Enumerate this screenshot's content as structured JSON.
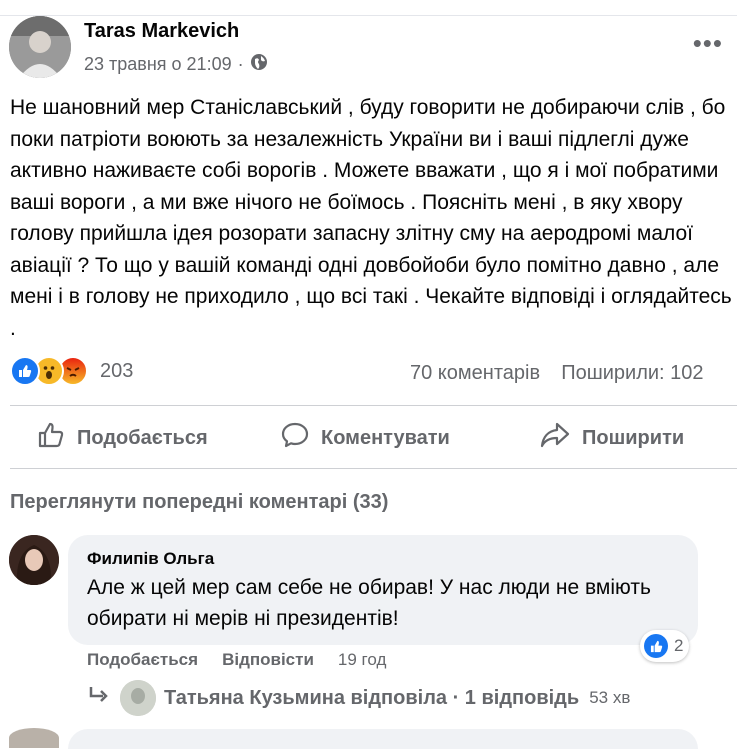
{
  "post": {
    "author": "Taras Markevich",
    "timestamp": "23 травня о 21:09",
    "separator": "·",
    "audience_icon": "globe-icon",
    "more_icon": "more-options-icon",
    "more_label": "•••",
    "text": "Не шановний мер Станіславський , буду говорити не добираючи слів , бо поки патріоти воюють за незалежність України ви і ваші підлеглі дуже активно наживаєте собі ворогів . Можете вважати , що я і мої побратими ваші вороги , а ми вже нічого не боїмось . Поясніть мені , в яку хвору голову прийшла ідея розорати запасну злітну сму на аеродромі малої авіації ? То що у вашій команді одні довбойоби було помітно давно , але мені і в голову не приходило , що всі такі . Чекайте відповіді і оглядайтесь .",
    "reactions": {
      "icons": [
        "like-icon",
        "wow-icon",
        "angry-icon"
      ],
      "count": "203"
    },
    "comments_count": "70 коментарів",
    "shares_count": "Поширили: 102"
  },
  "actions": {
    "like": "Подобається",
    "comment": "Коментувати",
    "share": "Поширити"
  },
  "comments": {
    "view_previous": "Переглянути попередні коментарі (33)",
    "items": [
      {
        "author": "Филипів Ольга",
        "text": "Але ж цей мер сам себе не обирав! У нас люди не вміють обирати ні мерів ні президентів!",
        "reaction_count": "2",
        "like_label": "Подобається",
        "reply_label": "Відповісти",
        "time": "19 год",
        "reply_summary": {
          "text": "Татьяна Кузьмина відповіла · 1 відповідь",
          "time": "53 хв"
        }
      }
    ]
  },
  "colors": {
    "like_blue": "#1877f2",
    "wow_yellow": "#f7b928",
    "angry_orange": "#e9710f",
    "secondary_text": "#65676b"
  }
}
